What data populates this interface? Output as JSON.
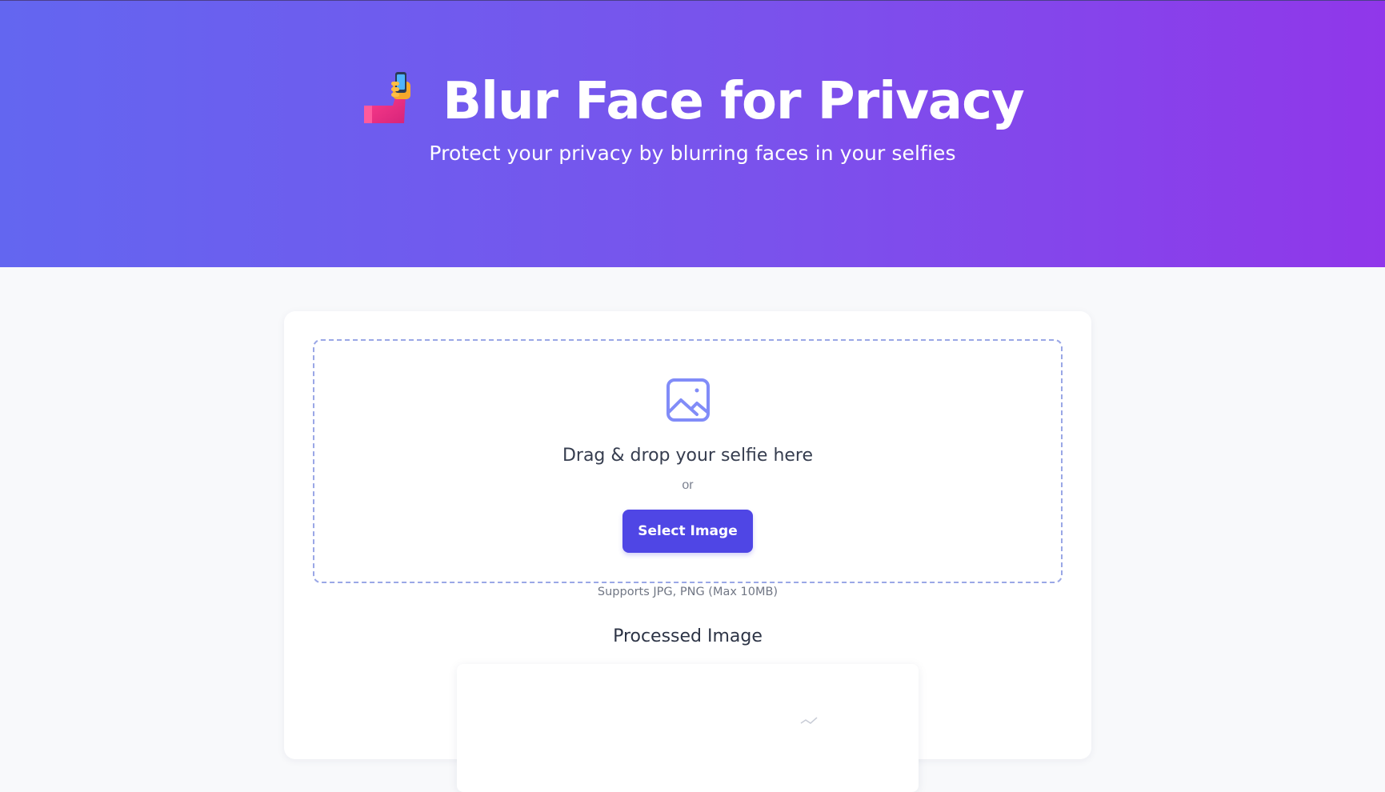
{
  "header": {
    "icon": "selfie-icon",
    "title": "Blur Face for Privacy",
    "subtitle": "Protect your privacy by blurring faces in your selfies"
  },
  "upload": {
    "icon": "image-icon",
    "drop_text": "Drag & drop your selfie here",
    "or_text": "or",
    "button_label": "Select Image",
    "supports_text": "Supports JPG, PNG (Max 10MB)"
  },
  "result": {
    "title": "Processed Image"
  },
  "colors": {
    "gradient_start": "#6366f0",
    "gradient_end": "#9037ea",
    "accent": "#4f46e5",
    "dropzone_border": "#9aa7e6"
  }
}
